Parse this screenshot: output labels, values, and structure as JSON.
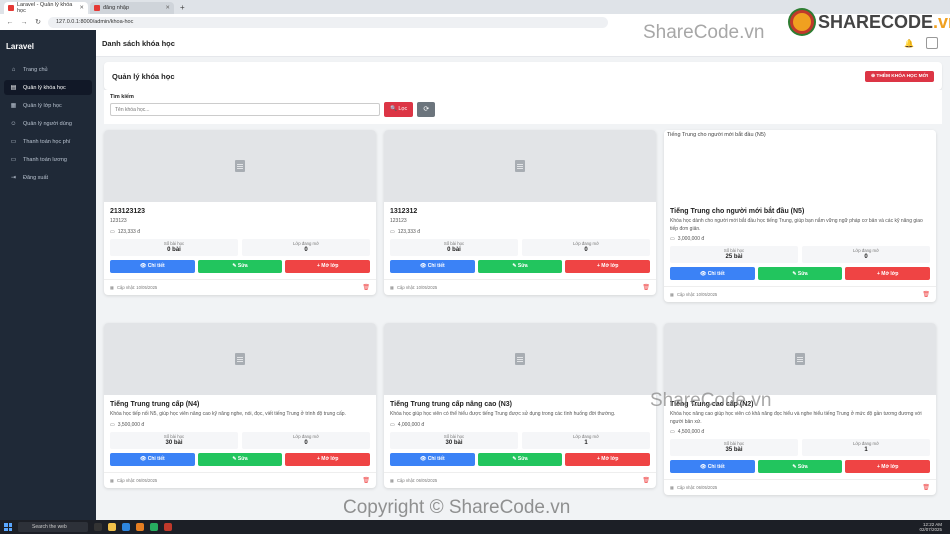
{
  "browser": {
    "tabs": [
      {
        "label": "Laravel - Quản lý khóa học",
        "active": true
      },
      {
        "label": "đăng nhập",
        "active": false
      }
    ],
    "new_tab": "+",
    "url": "127.0.0.1:8000/admin/khoa-hoc"
  },
  "sidebar": {
    "brand": "Laravel",
    "items": [
      {
        "label": "Trang chủ",
        "icon": "home-icon",
        "glyph": "⌂",
        "active": false
      },
      {
        "label": "Quản lý khóa học",
        "icon": "book-icon",
        "glyph": "▤",
        "active": true
      },
      {
        "label": "Quản lý lớp học",
        "icon": "class-icon",
        "glyph": "▦",
        "active": false
      },
      {
        "label": "Quản lý người dùng",
        "icon": "users-icon",
        "glyph": "☺",
        "active": false
      },
      {
        "label": "Thanh toán học phí",
        "icon": "payment-icon",
        "glyph": "▭",
        "active": false
      },
      {
        "label": "Thanh toán lương",
        "icon": "salary-icon",
        "glyph": "▭",
        "active": false
      },
      {
        "label": "Đăng xuất",
        "icon": "logout-icon",
        "glyph": "⇥",
        "active": false
      }
    ]
  },
  "topbar": {
    "title": "Danh sách khóa học",
    "bell_icon": "bell-icon"
  },
  "page": {
    "heading": "Quản lý khóa học",
    "add_button": "⊕ THÊM KHÓA HỌC MỚI",
    "search_label": "Tìm kiếm",
    "search_placeholder": "Tên khóa học...",
    "filter_button": "🔍 Lọc",
    "reset_icon": "⟳"
  },
  "labels": {
    "lessons": "Số bài học",
    "classes": "Lớp đang mở",
    "detail": "👁 Chi tiết",
    "edit": "✎ Sửa",
    "open_class": "+ Mở lớp"
  },
  "courses": [
    {
      "name": "213123123",
      "desc": "123123",
      "price": "123,333 đ",
      "lessons": "0 bài",
      "classes": "0",
      "updated": "Cập nhật: 10/05/2025",
      "image_alt": ""
    },
    {
      "name": "1312312",
      "desc": "123123",
      "price": "123,333 đ",
      "lessons": "0 bài",
      "classes": "0",
      "updated": "Cập nhật: 10/05/2025",
      "image_alt": ""
    },
    {
      "name": "Tiếng Trung cho người mới bắt đầu (N5)",
      "desc": "Khóa học dành cho người mới bắt đầu học tiếng Trung, giúp bạn nắm vững ngữ pháp cơ bản và các kỹ năng giao tiếp đơn giản.",
      "price": "3,000,000 đ",
      "lessons": "25 bài",
      "classes": "0",
      "updated": "Cập nhật: 10/05/2025",
      "image_alt": "Tiếng Trung cho người mới bắt đầu (N5)"
    },
    {
      "name": "Tiếng Trung trung cấp (N4)",
      "desc": "Khóa học tiếp nối N5, giúp học viên nâng cao kỹ năng nghe, nói, đọc, viết tiếng Trung ở trình độ trung cấp.",
      "price": "3,500,000 đ",
      "lessons": "30 bài",
      "classes": "0",
      "updated": "Cập nhật: 06/05/2025",
      "image_alt": ""
    },
    {
      "name": "Tiếng Trung trung cấp nâng cao (N3)",
      "desc": "Khóa học giúp học viên có thể hiểu được tiếng Trung được sử dụng trong các tình huống đời thường.",
      "price": "4,000,000 đ",
      "lessons": "30 bài",
      "classes": "1",
      "updated": "Cập nhật: 06/05/2025",
      "image_alt": ""
    },
    {
      "name": "Tiếng Trung cao cấp (N2)",
      "desc": "Khóa học nâng cao giúp học viên có khả năng đọc hiểu và nghe hiểu tiếng Trung ở mức độ gần tương đương với người bản xứ.",
      "price": "4,500,000 đ",
      "lessons": "35 bài",
      "classes": "1",
      "updated": "Cập nhật: 06/05/2025",
      "image_alt": ""
    }
  ],
  "taskbar": {
    "search": "Search the web",
    "time": "12:22 AM",
    "date": "02/07/2025"
  },
  "watermark": {
    "logo_prefix": "SHARE",
    "logo_suffix": "CODE",
    "logo_tld": ".vn",
    "text1": "ShareCode.vn",
    "text2": "ShareCode.vn",
    "copyright": "Copyright © ShareCode.vn"
  }
}
